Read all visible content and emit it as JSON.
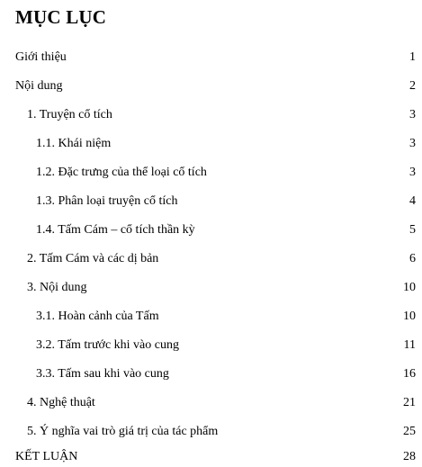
{
  "document": {
    "title": "MỤC LỤC",
    "entries": [
      {
        "label": "Giới thiệu",
        "page": "1"
      },
      {
        "label": "Nội dung",
        "page": "2"
      },
      {
        "label": "1.  Truyện cổ tích",
        "page": "3"
      },
      {
        "label": "1.1. Khái niệm",
        "page": "3"
      },
      {
        "label": "1.2. Đặc trưng của thể loại cổ tích",
        "page": "3"
      },
      {
        "label": "1.3. Phân loại truyện cổ tích",
        "page": "4"
      },
      {
        "label": "1.4. Tấm Cám – cổ tích thần kỳ",
        "page": "5"
      },
      {
        "label": "2.  Tấm Cám và các dị bản",
        "page": "6"
      },
      {
        "label": "3.  Nội dung",
        "page": "10"
      },
      {
        "label": "3.1. Hoàn cảnh của Tấm",
        "page": "10"
      },
      {
        "label": "3.2. Tấm trước khi vào cung",
        "page": "11"
      },
      {
        "label": "3.3. Tấm sau khi vào cung",
        "page": "16"
      },
      {
        "label": "4.  Nghệ thuật",
        "page": "21"
      },
      {
        "label": "5.  Ý nghĩa vai trò giá trị của tác phẩm",
        "page": "25"
      },
      {
        "label": "KẾT LUẬN",
        "page": "28"
      }
    ]
  }
}
